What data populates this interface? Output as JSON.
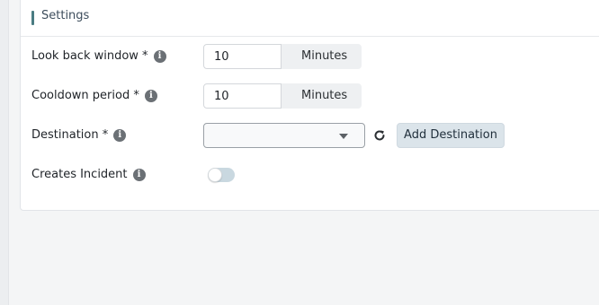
{
  "card": {
    "title": "Settings"
  },
  "look_back": {
    "label": "Look back window *",
    "value": "10",
    "unit": "Minutes"
  },
  "cooldown": {
    "label": "Cooldown period *",
    "value": "10",
    "unit": "Minutes"
  },
  "destination": {
    "label": "Destination *",
    "selected": "",
    "add_label": "Add Destination"
  },
  "incident": {
    "label": "Creates Incident",
    "enabled": false
  },
  "icons": {
    "info": "info-icon",
    "refresh": "refresh-icon",
    "dropdown": "chevron-down-icon"
  },
  "colors": {
    "accent": "#4a7c82",
    "button_bg": "#dbe4ea",
    "toggle_off": "#c9d8e0"
  }
}
